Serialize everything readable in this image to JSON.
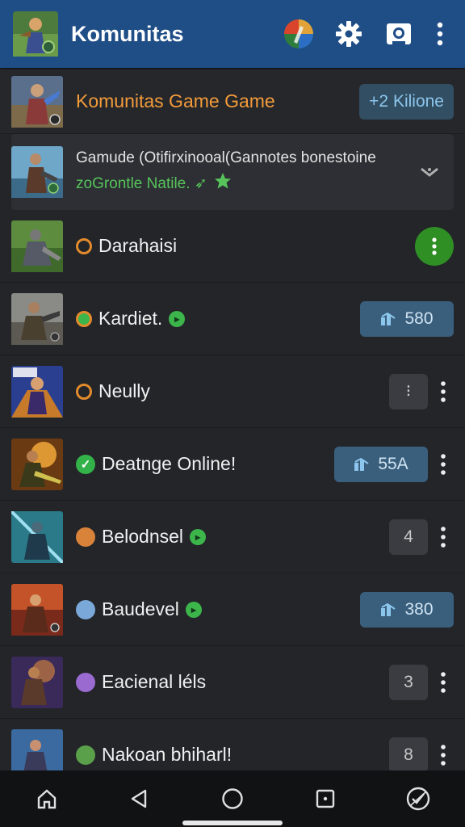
{
  "appbar": {
    "title": "Komunitas",
    "icons": [
      "game-avatar",
      "colorful-globe-icon",
      "settings-gear-icon",
      "camera-icon",
      "more-vert-icon"
    ]
  },
  "header": {
    "title": "Komunitas Game Game",
    "count": "+2 Kilione"
  },
  "promo": {
    "line1": "Gamude (Otifirxinooal(Gannotes bonestoine",
    "line2": "zoGrontle Natile. ➶",
    "menu_icon": "chevron-down-icon"
  },
  "rows": [
    {
      "name": "Darahaisi",
      "status": "ring",
      "after": false,
      "trail": "more-green",
      "value": ""
    },
    {
      "name": "Kardiet.",
      "status": "ring-green",
      "after": true,
      "trail": "blue",
      "value": "580"
    },
    {
      "name": "Neully",
      "status": "ring",
      "after": false,
      "trail": "gray",
      "value": "⁝"
    },
    {
      "name": "Deatnge Online!",
      "status": "check",
      "after": false,
      "trail": "blue",
      "value": "55A"
    },
    {
      "name": "Belodnsel",
      "status": "avatar-orange",
      "after": true,
      "trail": "gray",
      "value": "4"
    },
    {
      "name": "Baudevel",
      "status": "avatar-blue",
      "after": true,
      "trail": "blue",
      "value": "380"
    },
    {
      "name": "Eacienal léls",
      "status": "avatar-purple",
      "after": false,
      "trail": "gray",
      "value": "3"
    },
    {
      "name": "Nakoan bhiharl!",
      "status": "avatar-green",
      "after": false,
      "trail": "gray",
      "value": "8"
    }
  ],
  "colors": {
    "appbar": "#1f4e87",
    "background": "#232529",
    "accent_orange": "#f39b3a",
    "accent_green": "#34b24a",
    "pill_blue": "#3a5f7d"
  },
  "nav": [
    "home-icon",
    "back-icon",
    "circle-home-icon",
    "recents-icon",
    "game-badge-icon"
  ]
}
